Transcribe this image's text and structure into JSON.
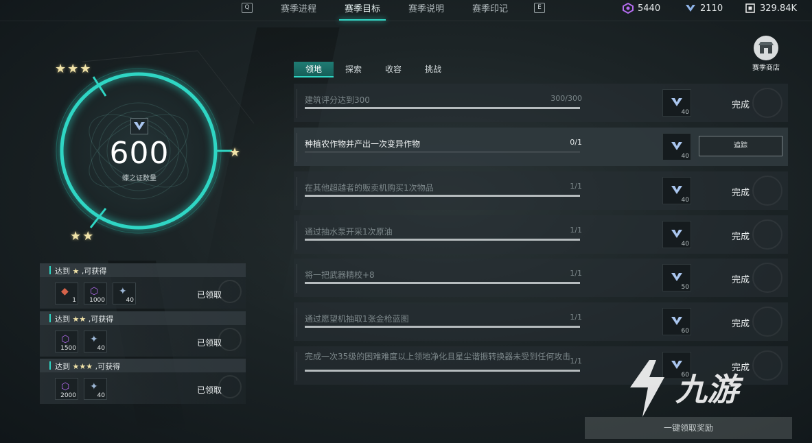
{
  "top_nav": {
    "left_key": "Q",
    "tabs": [
      {
        "label": "赛季进程"
      },
      {
        "label": "赛季目标"
      },
      {
        "label": "赛季说明"
      },
      {
        "label": "赛季印记"
      }
    ],
    "right_key": "E",
    "active_tab_index": 1
  },
  "currencies": [
    {
      "icon": "crystal-icon",
      "value": "5440",
      "color": "#b56cf0"
    },
    {
      "icon": "butterfly-token-icon",
      "value": "2110",
      "color": "#8fb4e8"
    },
    {
      "icon": "shard-icon",
      "value": "329.84K",
      "color": "#e6e6e6"
    }
  ],
  "progress_ring": {
    "value": "600",
    "label": "蝶之证数量",
    "accent": "#2fd6c4"
  },
  "tiers": [
    {
      "prefix": "达到",
      "suffix": ",可获得",
      "stars": [
        "★"
      ],
      "items": [
        {
          "icon": "ticket-icon",
          "count": "1"
        },
        {
          "icon": "crystal-icon",
          "count": "1000"
        },
        {
          "icon": "material-icon",
          "count": "40"
        }
      ],
      "status": "已领取"
    },
    {
      "prefix": "达到",
      "suffix": ",可获得",
      "stars": [
        "★",
        "★"
      ],
      "items": [
        {
          "icon": "crystal-icon",
          "count": "1500"
        },
        {
          "icon": "material-icon",
          "count": "40"
        }
      ],
      "status": "已领取"
    },
    {
      "prefix": "达到",
      "suffix": ",可获得",
      "stars": [
        "★",
        "★",
        "★"
      ],
      "items": [
        {
          "icon": "crystal-icon",
          "count": "2000"
        },
        {
          "icon": "material-icon",
          "count": "40"
        }
      ],
      "status": "已领取"
    }
  ],
  "category_tabs": [
    {
      "label": "领地"
    },
    {
      "label": "探索"
    },
    {
      "label": "收容"
    },
    {
      "label": "挑战"
    }
  ],
  "tasks": [
    {
      "name": "建筑评分达到300",
      "progress": "300/300",
      "fraction": 1,
      "reward": "40",
      "status": "完成",
      "state": "done"
    },
    {
      "name": "种植农作物并产出一次变异作物",
      "progress": "0/1",
      "fraction": 0,
      "reward": "40",
      "status": "追踪",
      "state": "active"
    },
    {
      "name": "在其他超越者的贩卖机购买1次物品",
      "progress": "1/1",
      "fraction": 1,
      "reward": "40",
      "status": "完成",
      "state": "done"
    },
    {
      "name": "通过抽水泵开采1次原油",
      "progress": "1/1",
      "fraction": 1,
      "reward": "40",
      "status": "完成",
      "state": "done"
    },
    {
      "name": "将一把武器精校+8",
      "progress": "1/1",
      "fraction": 1,
      "reward": "50",
      "status": "完成",
      "state": "done"
    },
    {
      "name": "通过愿望机抽取1张金枪蓝图",
      "progress": "1/1",
      "fraction": 1,
      "reward": "60",
      "status": "完成",
      "state": "done"
    },
    {
      "name": "完成一次35级的困难难度以上领地净化且星尘谐振转换器未受到任何攻击",
      "progress": "1/1",
      "fraction": 1,
      "reward": "60",
      "status": "完成",
      "state": "done"
    }
  ],
  "shop": {
    "label": "赛季商店"
  },
  "claim_all": {
    "label": "一键领取奖励"
  },
  "watermark": {
    "text": "九游"
  }
}
